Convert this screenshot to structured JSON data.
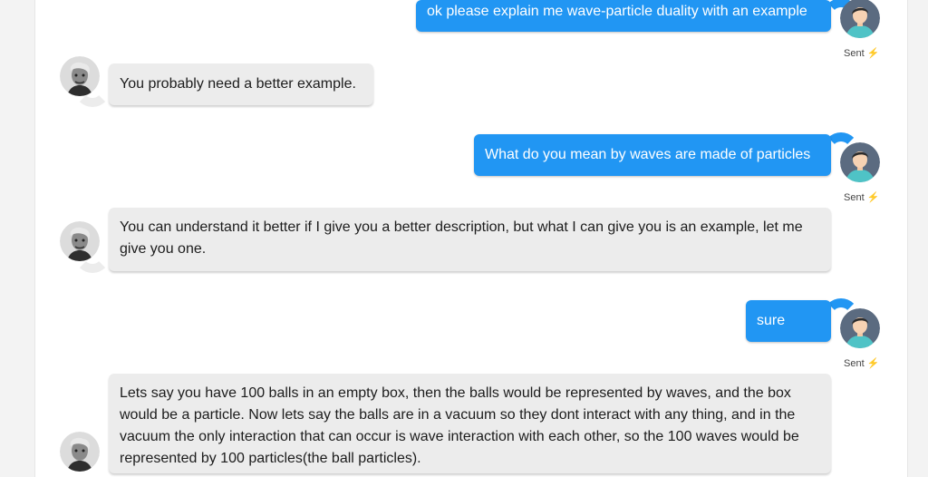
{
  "messages": [
    {
      "role": "user",
      "text": "ok please explain me wave-particle duality with an example",
      "status": "Sent",
      "status_icon": "⚡"
    },
    {
      "role": "bot",
      "text": "You probably need a better example."
    },
    {
      "role": "user",
      "text": "What do you mean by waves are made of particles",
      "status": "Sent",
      "status_icon": "⚡"
    },
    {
      "role": "bot",
      "text": "You can understand it better if I give you a better description, but what I can give you is an example, let me give you one."
    },
    {
      "role": "user",
      "text": "sure",
      "status": "Sent",
      "status_icon": "⚡"
    },
    {
      "role": "bot",
      "text": "Lets say you have 100 balls in an empty box, then the balls would be represented by waves, and the box would be a particle. Now lets say the balls are in a vacuum so they dont interact with any thing, and in the vacuum the only interaction that can occur is wave interaction with each other, so the 100 waves would be represented by 100 particles(the ball particles)."
    }
  ],
  "avatars": {
    "user": "user-avatar-icon",
    "bot": "bot-avatar-photo"
  },
  "colors": {
    "user_bubble": "#2196f3",
    "bot_bubble": "#ececec",
    "status_bolt": "#f2b21b"
  }
}
